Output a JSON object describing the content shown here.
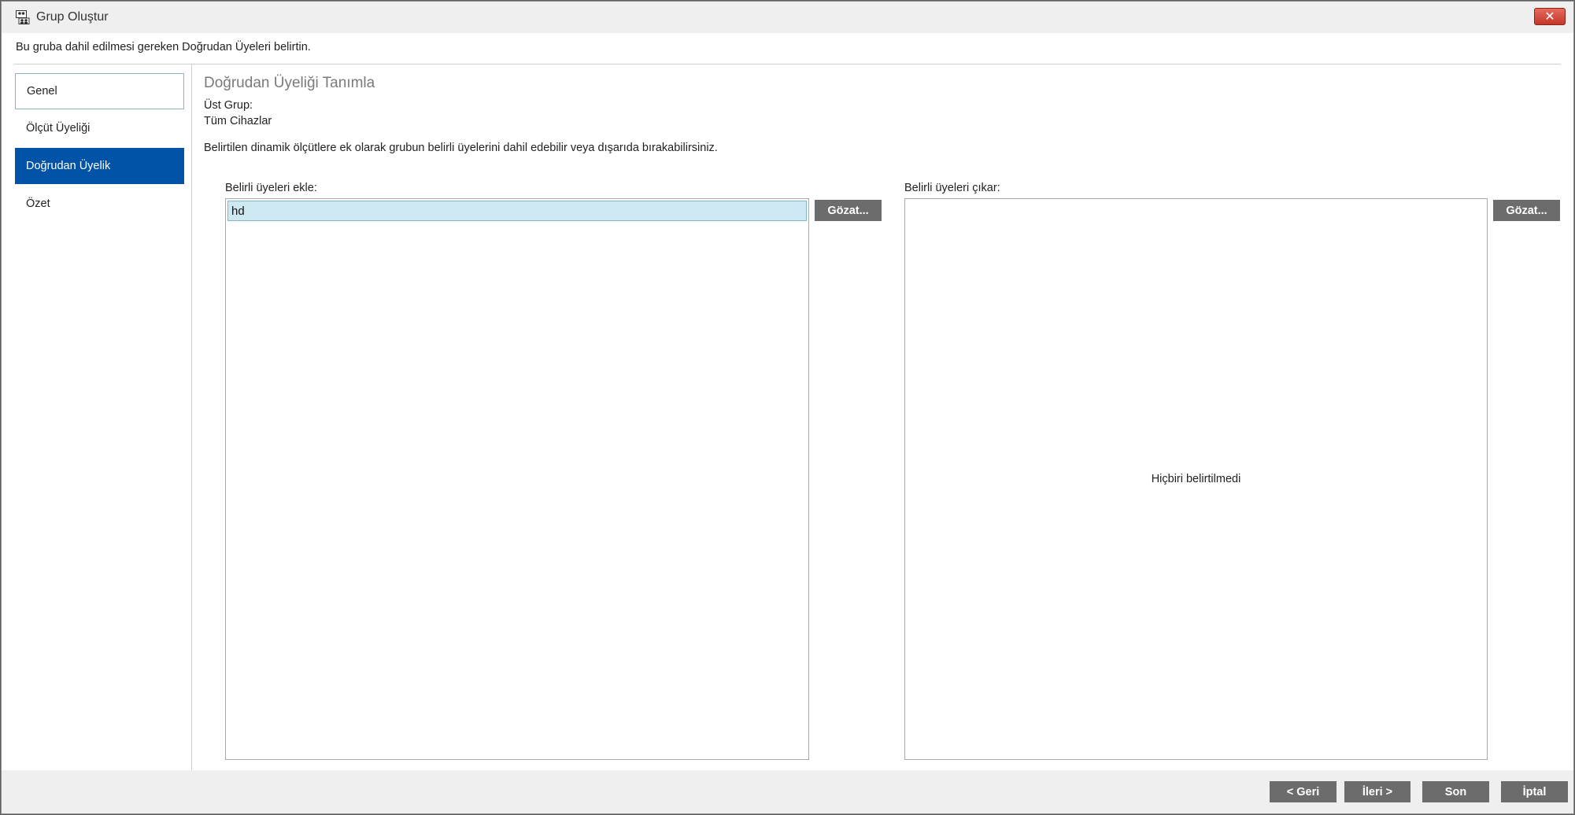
{
  "window": {
    "title": "Grup Oluştur",
    "close_label": "✕"
  },
  "instruction": "Bu gruba dahil edilmesi gereken Doğrudan Üyeleri belirtin.",
  "nav": {
    "items": [
      {
        "label": "Genel"
      },
      {
        "label": "Ölçüt Üyeliği"
      },
      {
        "label": "Doğrudan Üyelik"
      },
      {
        "label": "Özet"
      }
    ]
  },
  "main": {
    "title": "Doğrudan Üyeliği Tanımla",
    "parent_group_label": "Üst Grup:",
    "parent_group_value": "Tüm Cihazlar",
    "description": "Belirtilen dinamik ölçütlere ek olarak grubun belirli üyelerini dahil edebilir veya dışarıda bırakabilirsiniz.",
    "include": {
      "label": "Belirli üyeleri ekle:",
      "items": [
        "hd"
      ],
      "browse_label": "Gözat..."
    },
    "exclude": {
      "label": "Belirli üyeleri çıkar:",
      "empty_text": "Hiçbiri belirtilmedi",
      "browse_label": "Gözat..."
    }
  },
  "footer": {
    "back_label": "< Geri",
    "next_label": "İleri >",
    "finish_label": "Son",
    "cancel_label": "İptal"
  }
}
